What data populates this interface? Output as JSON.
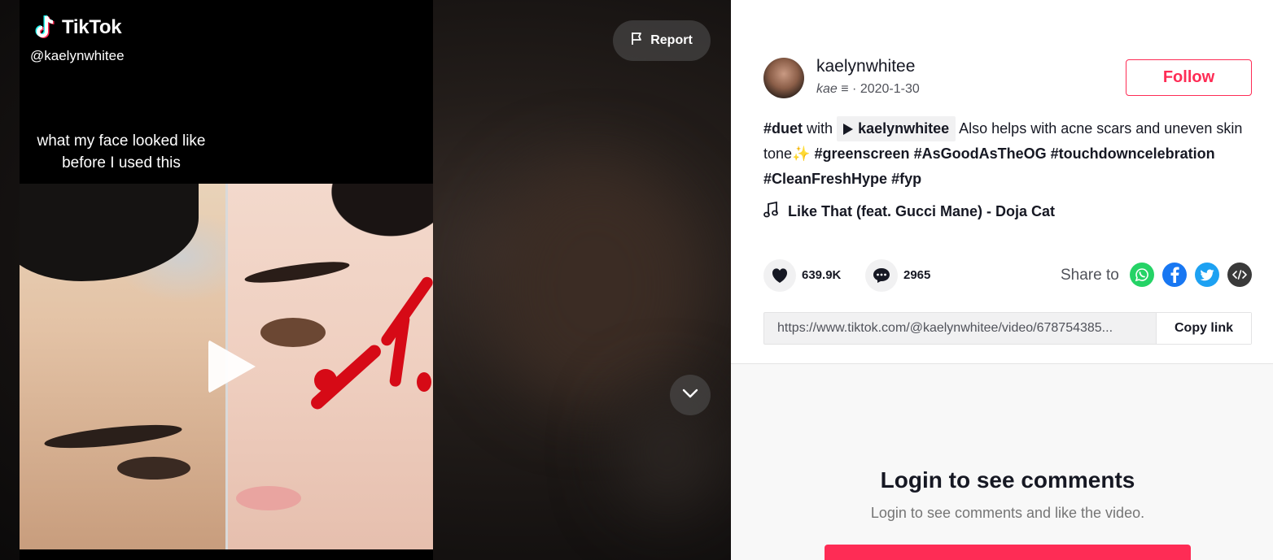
{
  "app": {
    "logo_text": "TikTok"
  },
  "video": {
    "handle": "@kaelynwhitee",
    "caption_line1": "what my face looked like",
    "caption_line2": "before I used this",
    "report_label": "Report"
  },
  "author": {
    "username": "kaelynwhitee",
    "nickname": "kae ≡",
    "date": "2020-1-30",
    "follow_label": "Follow"
  },
  "description": {
    "duet_tag": "#duet",
    "with_word": "with",
    "duet_user": "kaelynwhitee",
    "text": "Also helps with acne scars and uneven skin tone",
    "sparkle": "✨",
    "tags": [
      "#greenscreen",
      "#AsGoodAsTheOG",
      "#touchdowncelebration",
      "#CleanFreshHype",
      "#fyp"
    ]
  },
  "music": {
    "title": "Like That (feat. Gucci Mane) - Doja Cat"
  },
  "stats": {
    "likes": "639.9K",
    "comments": "2965"
  },
  "share": {
    "label": "Share to",
    "targets": [
      "whatsapp-icon",
      "facebook-icon",
      "twitter-icon",
      "embed-icon"
    ],
    "colors": {
      "whatsapp": "#25d366",
      "facebook": "#1877f2",
      "twitter": "#1da1f2",
      "embed": "#3a3a3a"
    }
  },
  "link": {
    "url": "https://www.tiktok.com/@kaelynwhitee/video/678754385...",
    "copy_label": "Copy link"
  },
  "comments": {
    "login_title": "Login to see comments",
    "login_subtitle": "Login to see comments and like the video."
  },
  "colors": {
    "accent": "#fe2c55",
    "text": "#161823",
    "muted": "#50525a"
  }
}
